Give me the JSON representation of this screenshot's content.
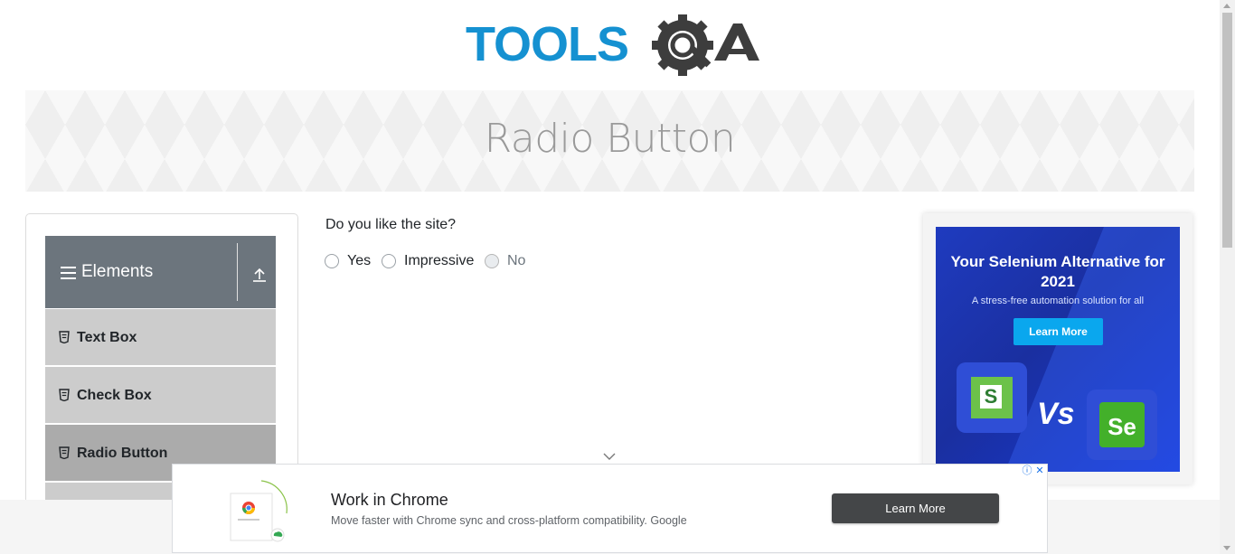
{
  "header": {
    "logo_text": "TOOLSQA"
  },
  "banner": {
    "title": "Radio Button"
  },
  "sidebar": {
    "group_title": "Elements",
    "items": [
      {
        "label": "Text Box",
        "active": false
      },
      {
        "label": "Check Box",
        "active": false
      },
      {
        "label": "Radio Button",
        "active": true
      }
    ]
  },
  "main": {
    "question": "Do you like the site?",
    "options": [
      {
        "label": "Yes",
        "disabled": false,
        "checked": false
      },
      {
        "label": "Impressive",
        "disabled": false,
        "checked": false
      },
      {
        "label": "No",
        "disabled": true,
        "checked": false
      }
    ]
  },
  "ad_right": {
    "headline": "Your Selenium Alternative for 2021",
    "subline": "A stress-free automation solution for all",
    "button": "Learn More",
    "vs_text": "Vs",
    "tile_left": "S",
    "tile_right": "Se"
  },
  "ad_bottom": {
    "headline": "Work in Chrome",
    "body": "Move faster with Chrome sync and cross-platform compatibility. Google",
    "button": "Learn More"
  },
  "colors": {
    "logo_blue": "#1591d1",
    "logo_dark": "#3d3d3d",
    "sidebar_header": "#6c757d",
    "sidebar_item": "#cccccc",
    "sidebar_item_active": "#ababab"
  }
}
